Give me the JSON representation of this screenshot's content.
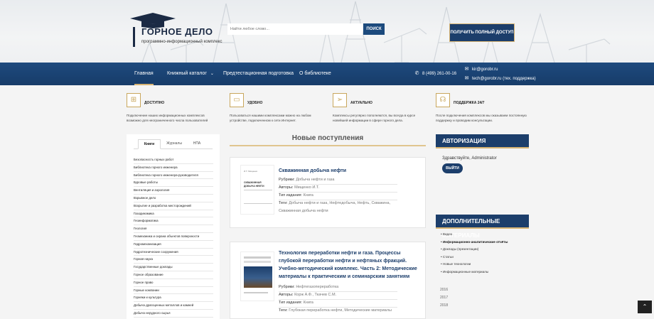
{
  "header": {
    "logo_title": "ГОРНОЕ ДЕЛО",
    "logo_subtitle": "программно-информационный комплекс",
    "search_placeholder": "Найти любое слово...",
    "search_button": "ПОИСК",
    "access_button": "ПОЛУЧИТЬ ПОЛНЫЙ ДОСТУП"
  },
  "nav": {
    "items": [
      "Главная",
      "Книжный каталог",
      "Предтестационная подготовка",
      "О библиотеке"
    ],
    "phone": "8 (499) 261-00-16",
    "email1": "kir@gorobr.ru",
    "email2": "tech@gorobr.ru (тех. поддержка)"
  },
  "features": [
    {
      "title": "ДОСТУПНО",
      "desc": "Подключение наших информационных комплексов возможно для неограниченного числа пользователей",
      "icon": "sitemap-icon"
    },
    {
      "title": "УДОБНО",
      "desc": "Пользоваться нашими комплексами можно на любом устройстве, подключенном к сети Интернет.",
      "icon": "device-icon"
    },
    {
      "title": "АКТУАЛЬНО",
      "desc": "Комплексы регулярно пополняются, вы всегда в курсе новейшей информации в сфере горного дела.",
      "icon": "paper-plane-icon"
    },
    {
      "title": "ПОДДЕРЖКА 24/7",
      "desc": "После подключения комплексов мы оказываем постоянную поддержку и проводим консультации.",
      "icon": "headset-icon"
    }
  ],
  "sidebar": {
    "tabs": [
      "Книги",
      "Журналы",
      "НПА"
    ],
    "categories": [
      "Безопасность горных работ",
      "Библиотека горного инженера",
      "Библиотека горного инженера-руководителя",
      "Буровые работы",
      "Вентиляция и аэрология",
      "Взрывное дело",
      "Вскрытие и разработка месторождений",
      "Газодинамика",
      "Геоинформатика",
      "Геология",
      "Геомеханика и охрана объектов поверхности",
      "Гидромеханизация",
      "Гидротехнические сооружения",
      "Горная наука",
      "Государственные доклады",
      "Горное образование",
      "Горное право",
      "Горные компании",
      "Горняки и культура",
      "Добыча драгоценных металлов и камней",
      "Добыча нерудного сырья"
    ]
  },
  "main": {
    "section_title": "Новые поступления",
    "books": [
      {
        "title": "Скважинная добыча нефти",
        "rubric_label": "Рубрики:",
        "rubric": "Добыча нефти и газа",
        "authors_label": "Авторы:",
        "authors": "Мищенко И.Т.",
        "type_label": "Тип издания:",
        "type": "Книга",
        "tags_label": "Теги:",
        "tags": "Добыча нефти и газа, Нефтедобыча, Нефть, Скважина, Скважинная добыча нефти",
        "cover_author": "И.Т. Мищенко",
        "cover_title": "СКВАЖИННАЯ ДОБЫЧА НЕФТИ"
      },
      {
        "title": "Технология переработки нефти и газа. Процессы глубокой переработки нефти и нефтяных фракций. Учебно-методический комплекс. Часть 2: Методические материалы к практическим и семинарским занятиям",
        "rubric_label": "Рубрики:",
        "rubric": "Нефтегазопереработка",
        "authors_label": "Авторы:",
        "authors": "Корж А.Ф., Ткачев С.М.",
        "type_label": "Тип издания:",
        "type": "Книга",
        "tags_label": "Теги:",
        "tags": "Глубокая переработка нефти, Методические материалы"
      }
    ]
  },
  "right": {
    "auth_title": "АВТОРИЗАЦИЯ",
    "greeting": "Здравствуйте, Administrator",
    "logout_button": "ВЫЙТИ",
    "extra_title": "ДОПОЛНИТЕЛЬНЫЕ МАТЕРИАЛЫ",
    "extra_items": [
      "• Видео",
      "• Информационно-аналитические отчёты",
      "• Доклады (презентации)",
      "• Статьи",
      "• Новые технологии",
      "• Информационные материалы"
    ],
    "years": [
      "2016",
      "2017",
      "2018"
    ]
  },
  "colors": {
    "navy": "#1c3e6b",
    "gold": "#d7b473",
    "nav_bg": "#1d4677"
  },
  "scroll_top_icon": "chevron-up-icon"
}
